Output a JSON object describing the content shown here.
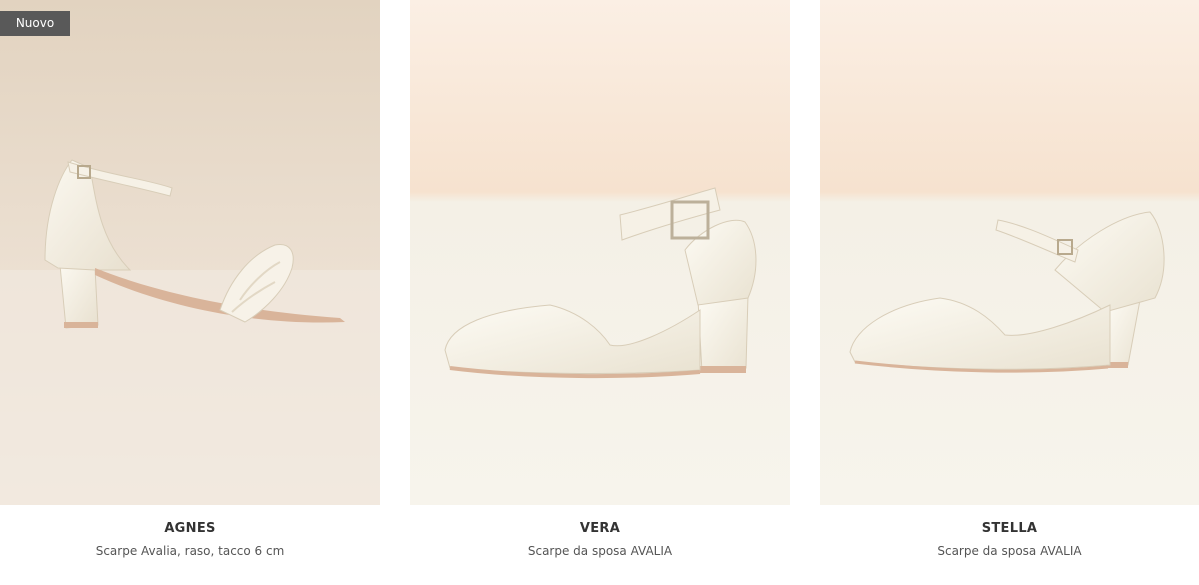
{
  "products": [
    {
      "badge": "Nuovo",
      "name": "AGNES",
      "description": "Scarpe Avalia, raso, tacco 6 cm"
    },
    {
      "badge": "",
      "name": "VERA",
      "description": "Scarpe da sposa AVALIA"
    },
    {
      "badge": "",
      "name": "STELLA",
      "description": "Scarpe da sposa AVALIA"
    }
  ],
  "colors": {
    "badge_bg": "#595959",
    "title": "#333333",
    "subtitle": "#555555"
  }
}
